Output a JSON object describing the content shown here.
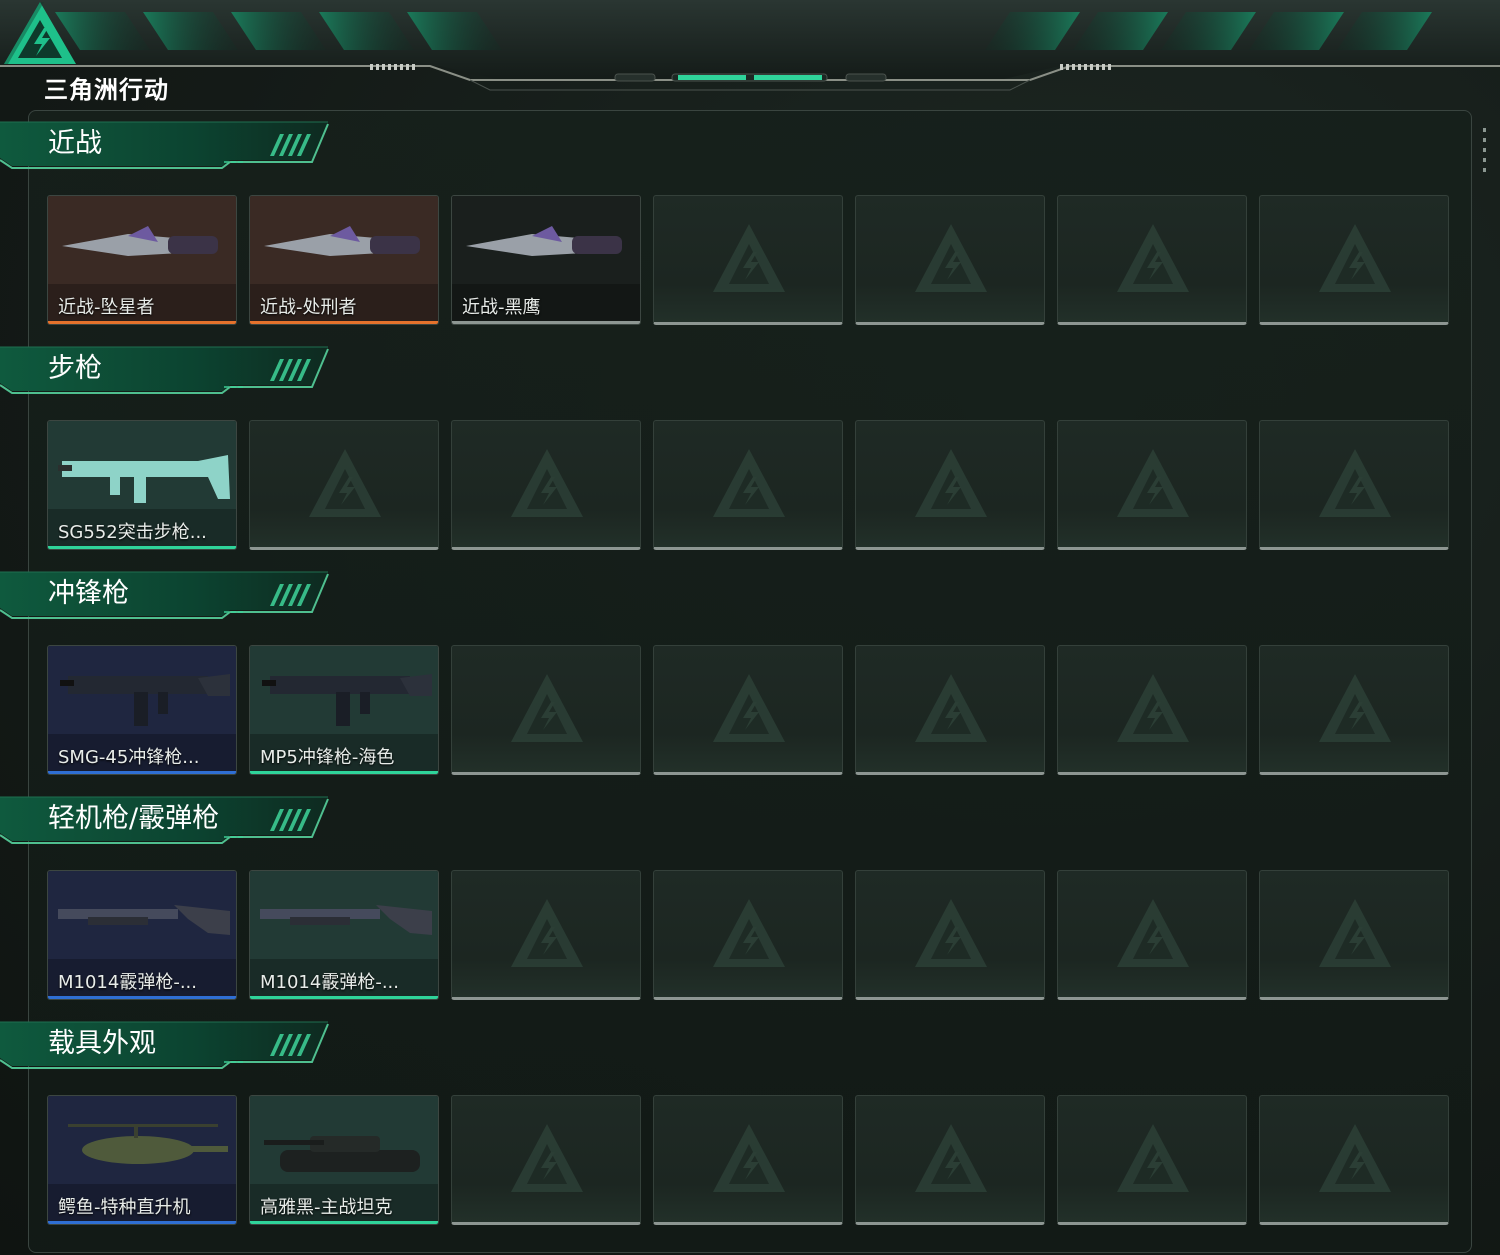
{
  "app": {
    "logo_text": "三角洲行动"
  },
  "colors": {
    "accent": "#2fd49a",
    "orange": "#e5722c",
    "green": "#2fd49a",
    "blue": "#2f6fd4",
    "empty": "#8d9692"
  },
  "sections": [
    {
      "title": "近战",
      "items": [
        {
          "label": "近战-坠星者",
          "rarity": "orange",
          "icon": "knife-icon"
        },
        {
          "label": "近战-处刑者",
          "rarity": "orange",
          "icon": "knife-icon"
        },
        {
          "label": "近战-黑鹰",
          "rarity": "none",
          "icon": "knife-icon"
        }
      ]
    },
    {
      "title": "步枪",
      "items": [
        {
          "label": "SG552突击步枪...",
          "rarity": "green",
          "icon": "rifle-icon"
        }
      ]
    },
    {
      "title": "冲锋枪",
      "items": [
        {
          "label": "SMG-45冲锋枪...",
          "rarity": "blue",
          "icon": "smg-icon"
        },
        {
          "label": "MP5冲锋枪-海色",
          "rarity": "green",
          "icon": "smg-icon"
        }
      ]
    },
    {
      "title": "轻机枪/霰弹枪",
      "items": [
        {
          "label": "M1014霰弹枪-...",
          "rarity": "blue",
          "icon": "shotgun-icon"
        },
        {
          "label": "M1014霰弹枪-...",
          "rarity": "green",
          "icon": "shotgun-icon"
        }
      ]
    },
    {
      "title": "载具外观",
      "items": [
        {
          "label": "鳄鱼-特种直升机",
          "rarity": "blue",
          "icon": "helicopter-icon"
        },
        {
          "label": "高雅黑-主战坦克",
          "rarity": "green",
          "icon": "tank-icon"
        }
      ]
    }
  ]
}
